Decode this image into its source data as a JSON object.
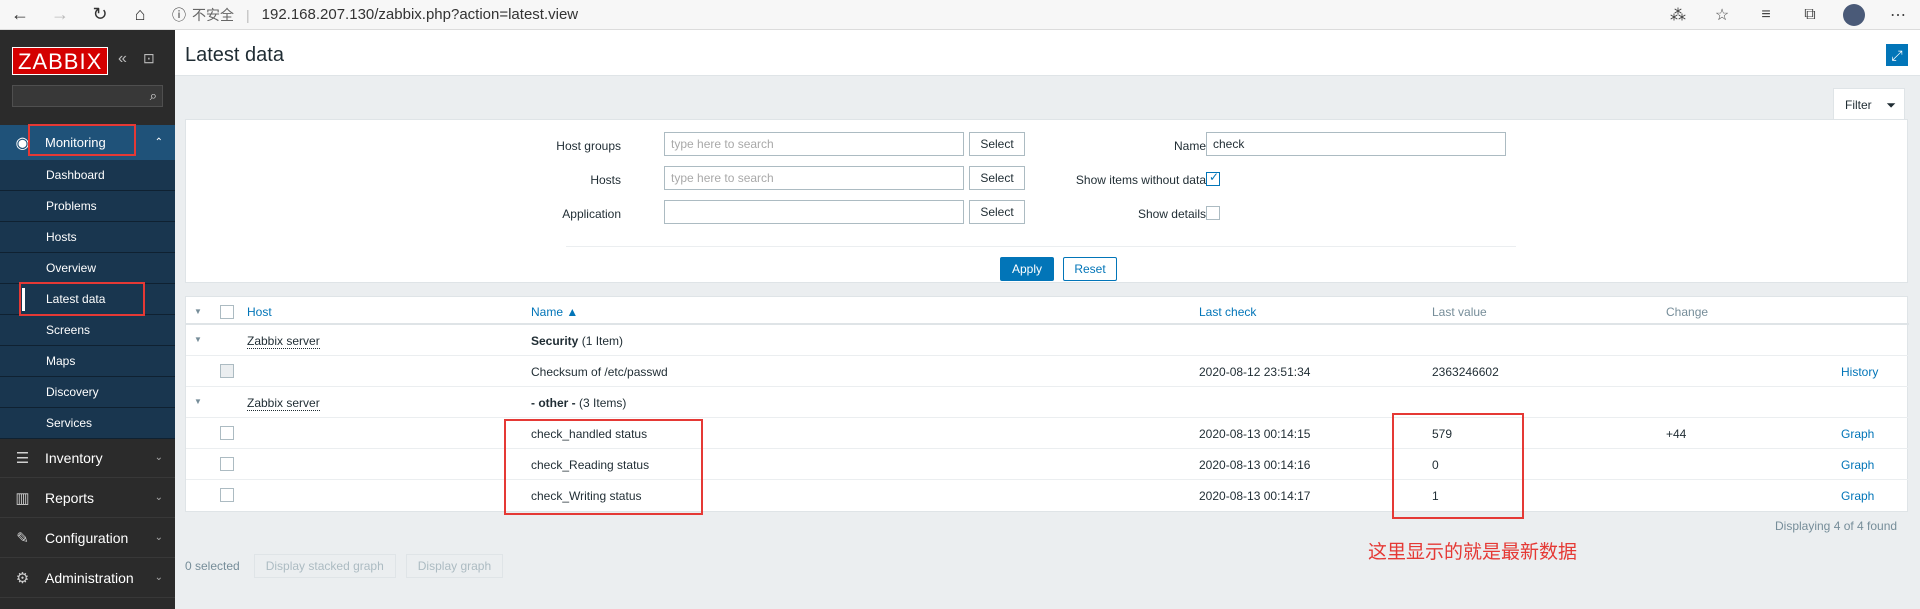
{
  "browser": {
    "security": "不安全",
    "url": "192.168.207.130/zabbix.php?action=latest.view"
  },
  "sidebar": {
    "brand": "ZABBIX",
    "monitoring": "Monitoring",
    "sub_items": [
      {
        "label": "Dashboard"
      },
      {
        "label": "Problems"
      },
      {
        "label": "Hosts"
      },
      {
        "label": "Overview"
      },
      {
        "label": "Latest data"
      },
      {
        "label": "Screens"
      },
      {
        "label": "Maps"
      },
      {
        "label": "Discovery"
      },
      {
        "label": "Services"
      }
    ],
    "menus": [
      {
        "label": "Inventory"
      },
      {
        "label": "Reports"
      },
      {
        "label": "Configuration"
      },
      {
        "label": "Administration"
      }
    ]
  },
  "page": {
    "title": "Latest data"
  },
  "filter": {
    "tab": "Filter",
    "host_groups_label": "Host groups",
    "hosts_label": "Hosts",
    "application_label": "Application",
    "placeholder": "type here to search",
    "select": "Select",
    "name_label": "Name",
    "name_value": "check",
    "show_without_data_label": "Show items without data",
    "show_details_label": "Show details",
    "apply": "Apply",
    "reset": "Reset"
  },
  "table": {
    "headers": {
      "host": "Host",
      "name": "Name ▲",
      "last_check": "Last check",
      "last_value": "Last value",
      "change": "Change"
    },
    "groups": [
      {
        "host": "Zabbix server",
        "app": "Security",
        "count": "(1 Item)"
      },
      {
        "host": "Zabbix server",
        "app": "- other -",
        "count": "(3 Items)"
      }
    ],
    "rows": [
      {
        "name": "Checksum of /etc/passwd",
        "last_check": "2020-08-12 23:51:34",
        "last_value": "2363246602",
        "change": "",
        "action": "History"
      },
      {
        "name": "check_handled status",
        "last_check": "2020-08-13 00:14:15",
        "last_value": "579",
        "change": "+44",
        "action": "Graph"
      },
      {
        "name": "check_Reading status",
        "last_check": "2020-08-13 00:14:16",
        "last_value": "0",
        "change": "",
        "action": "Graph"
      },
      {
        "name": "check_Writing status",
        "last_check": "2020-08-13 00:14:17",
        "last_value": "1",
        "change": "",
        "action": "Graph"
      }
    ],
    "footer": "Displaying 4 of 4 found"
  },
  "bottom": {
    "selected": "0 selected",
    "stacked": "Display stacked graph",
    "graph": "Display graph"
  },
  "annotation": "这里显示的就是最新数据"
}
